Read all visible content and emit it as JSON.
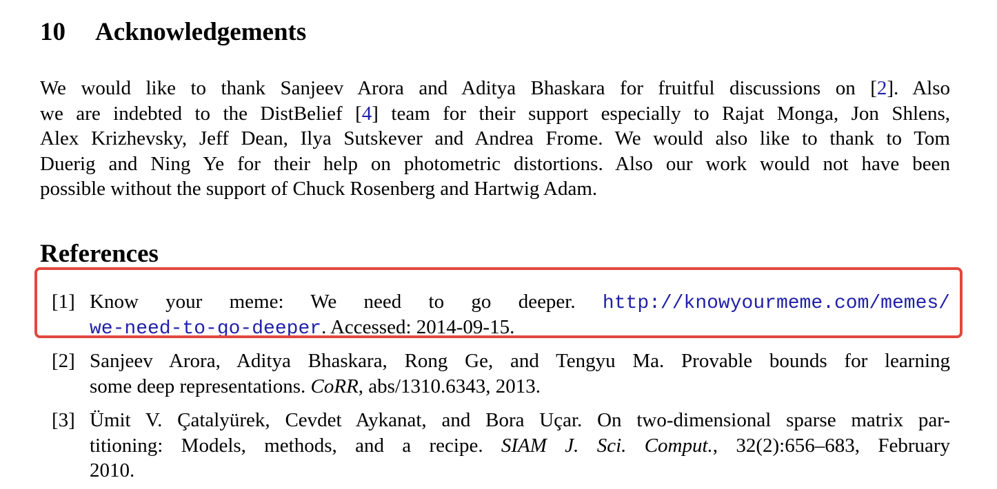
{
  "section": {
    "number": "10",
    "title": "Acknowledgements"
  },
  "acknowledgements": {
    "lines": [
      {
        "before": "We would like to thank Sanjeev Arora and Aditya Bhaskara for fruitful discussions on [",
        "cite": "2",
        "after": "].  Also"
      },
      {
        "before": "we are indebted to the DistBelief [",
        "cite": "4",
        "after": "] team for their support especially to Rajat Monga, Jon Shlens,"
      },
      {
        "before": "Alex Krizhevsky, Jeff Dean, Ilya Sutskever and Andrea Frome. We would also like to thank to Tom",
        "cite": "",
        "after": ""
      },
      {
        "before": "Duerig and Ning Ye for their help on photometric distortions.  Also our work would not have been",
        "cite": "",
        "after": ""
      },
      {
        "before": "possible without the support of Chuck Rosenberg and Hartwig Adam.",
        "cite": "",
        "after": ""
      }
    ]
  },
  "references": {
    "heading": "References",
    "items": [
      {
        "label": "[1]",
        "line1_text": "Know your meme:  We need to go deeper.  ",
        "line1_url": "http://knowyourmeme.com/memes/",
        "line2_url": "we-need-to-go-deeper",
        "line2_text": ". Accessed: 2014-09-15."
      },
      {
        "label": "[2]",
        "line1_text": "Sanjeev Arora, Aditya Bhaskara, Rong Ge, and Tengyu Ma.  Provable bounds for learning",
        "line2_pre": "some deep representations. ",
        "line2_italic": "CoRR",
        "line2_post": ", abs/1310.6343, 2013."
      },
      {
        "label": "[3]",
        "line1_text": "Ümit V. Çatalyürek, Cevdet Aykanat, and Bora Uçar.  On two-dimensional sparse matrix par-",
        "line2_pre": "titioning:  Models, methods, and a recipe.  ",
        "line2_italic": "SIAM J. Sci. Comput.",
        "line2_post": ", 32(2):656–683, February",
        "line3_text": "2010."
      }
    ]
  },
  "colors": {
    "link": "#1f1fa8",
    "highlight_border": "#e2473f"
  }
}
